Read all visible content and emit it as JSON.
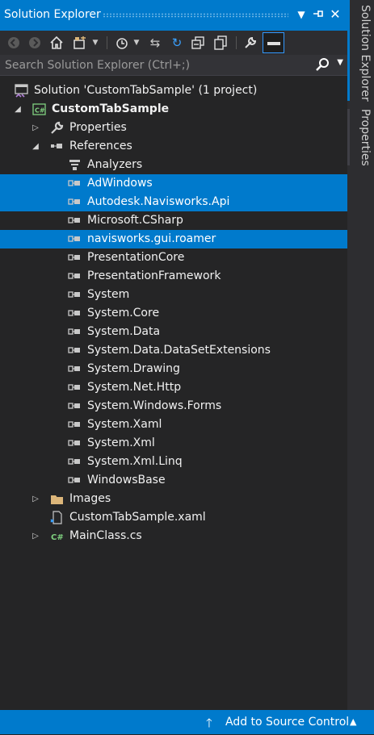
{
  "panel": {
    "title": "Solution Explorer",
    "side_tabs": [
      "Solution Explorer",
      "Properties"
    ]
  },
  "search": {
    "placeholder": "Search Solution Explorer (Ctrl+;)"
  },
  "tree": [
    {
      "label": "Solution 'CustomTabSample' (1 project)",
      "icon": "solution-icon",
      "level": 0,
      "expander": "none",
      "selected": false,
      "bold": false
    },
    {
      "label": "CustomTabSample",
      "icon": "csharp-project-icon",
      "level": 1,
      "expander": "expanded",
      "selected": false,
      "bold": true
    },
    {
      "label": "Properties",
      "icon": "wrench-icon",
      "level": 2,
      "expander": "collapsed",
      "selected": false,
      "bold": false
    },
    {
      "label": "References",
      "icon": "references-icon",
      "level": 2,
      "expander": "expanded",
      "selected": false,
      "bold": false
    },
    {
      "label": "Analyzers",
      "icon": "analyzers-icon",
      "level": 3,
      "expander": "none",
      "selected": false,
      "bold": false
    },
    {
      "label": "AdWindows",
      "icon": "reference-icon",
      "level": 3,
      "expander": "none",
      "selected": true,
      "bold": false
    },
    {
      "label": "Autodesk.Navisworks.Api",
      "icon": "reference-icon",
      "level": 3,
      "expander": "none",
      "selected": true,
      "bold": false
    },
    {
      "label": "Microsoft.CSharp",
      "icon": "reference-icon",
      "level": 3,
      "expander": "none",
      "selected": false,
      "bold": false
    },
    {
      "label": "navisworks.gui.roamer",
      "icon": "reference-icon",
      "level": 3,
      "expander": "none",
      "selected": true,
      "bold": false
    },
    {
      "label": "PresentationCore",
      "icon": "reference-icon",
      "level": 3,
      "expander": "none",
      "selected": false,
      "bold": false
    },
    {
      "label": "PresentationFramework",
      "icon": "reference-icon",
      "level": 3,
      "expander": "none",
      "selected": false,
      "bold": false
    },
    {
      "label": "System",
      "icon": "reference-icon",
      "level": 3,
      "expander": "none",
      "selected": false,
      "bold": false
    },
    {
      "label": "System.Core",
      "icon": "reference-icon",
      "level": 3,
      "expander": "none",
      "selected": false,
      "bold": false
    },
    {
      "label": "System.Data",
      "icon": "reference-icon",
      "level": 3,
      "expander": "none",
      "selected": false,
      "bold": false
    },
    {
      "label": "System.Data.DataSetExtensions",
      "icon": "reference-icon",
      "level": 3,
      "expander": "none",
      "selected": false,
      "bold": false
    },
    {
      "label": "System.Drawing",
      "icon": "reference-icon",
      "level": 3,
      "expander": "none",
      "selected": false,
      "bold": false
    },
    {
      "label": "System.Net.Http",
      "icon": "reference-icon",
      "level": 3,
      "expander": "none",
      "selected": false,
      "bold": false
    },
    {
      "label": "System.Windows.Forms",
      "icon": "reference-icon",
      "level": 3,
      "expander": "none",
      "selected": false,
      "bold": false
    },
    {
      "label": "System.Xaml",
      "icon": "reference-icon",
      "level": 3,
      "expander": "none",
      "selected": false,
      "bold": false
    },
    {
      "label": "System.Xml",
      "icon": "reference-icon",
      "level": 3,
      "expander": "none",
      "selected": false,
      "bold": false
    },
    {
      "label": "System.Xml.Linq",
      "icon": "reference-icon",
      "level": 3,
      "expander": "none",
      "selected": false,
      "bold": false
    },
    {
      "label": "WindowsBase",
      "icon": "reference-icon",
      "level": 3,
      "expander": "none",
      "selected": false,
      "bold": false
    },
    {
      "label": "Images",
      "icon": "folder-icon",
      "level": 2,
      "expander": "collapsed",
      "selected": false,
      "bold": false
    },
    {
      "label": "CustomTabSample.xaml",
      "icon": "xaml-file-icon",
      "level": 2,
      "expander": "none",
      "selected": false,
      "bold": false
    },
    {
      "label": "MainClass.cs",
      "icon": "csharp-file-icon",
      "level": 2,
      "expander": "collapsed",
      "selected": false,
      "bold": false
    }
  ],
  "statusbar": {
    "label": "Add to Source Control"
  },
  "colors": {
    "accent": "#007acc",
    "background": "#252526",
    "text": "#f1f1f1"
  }
}
